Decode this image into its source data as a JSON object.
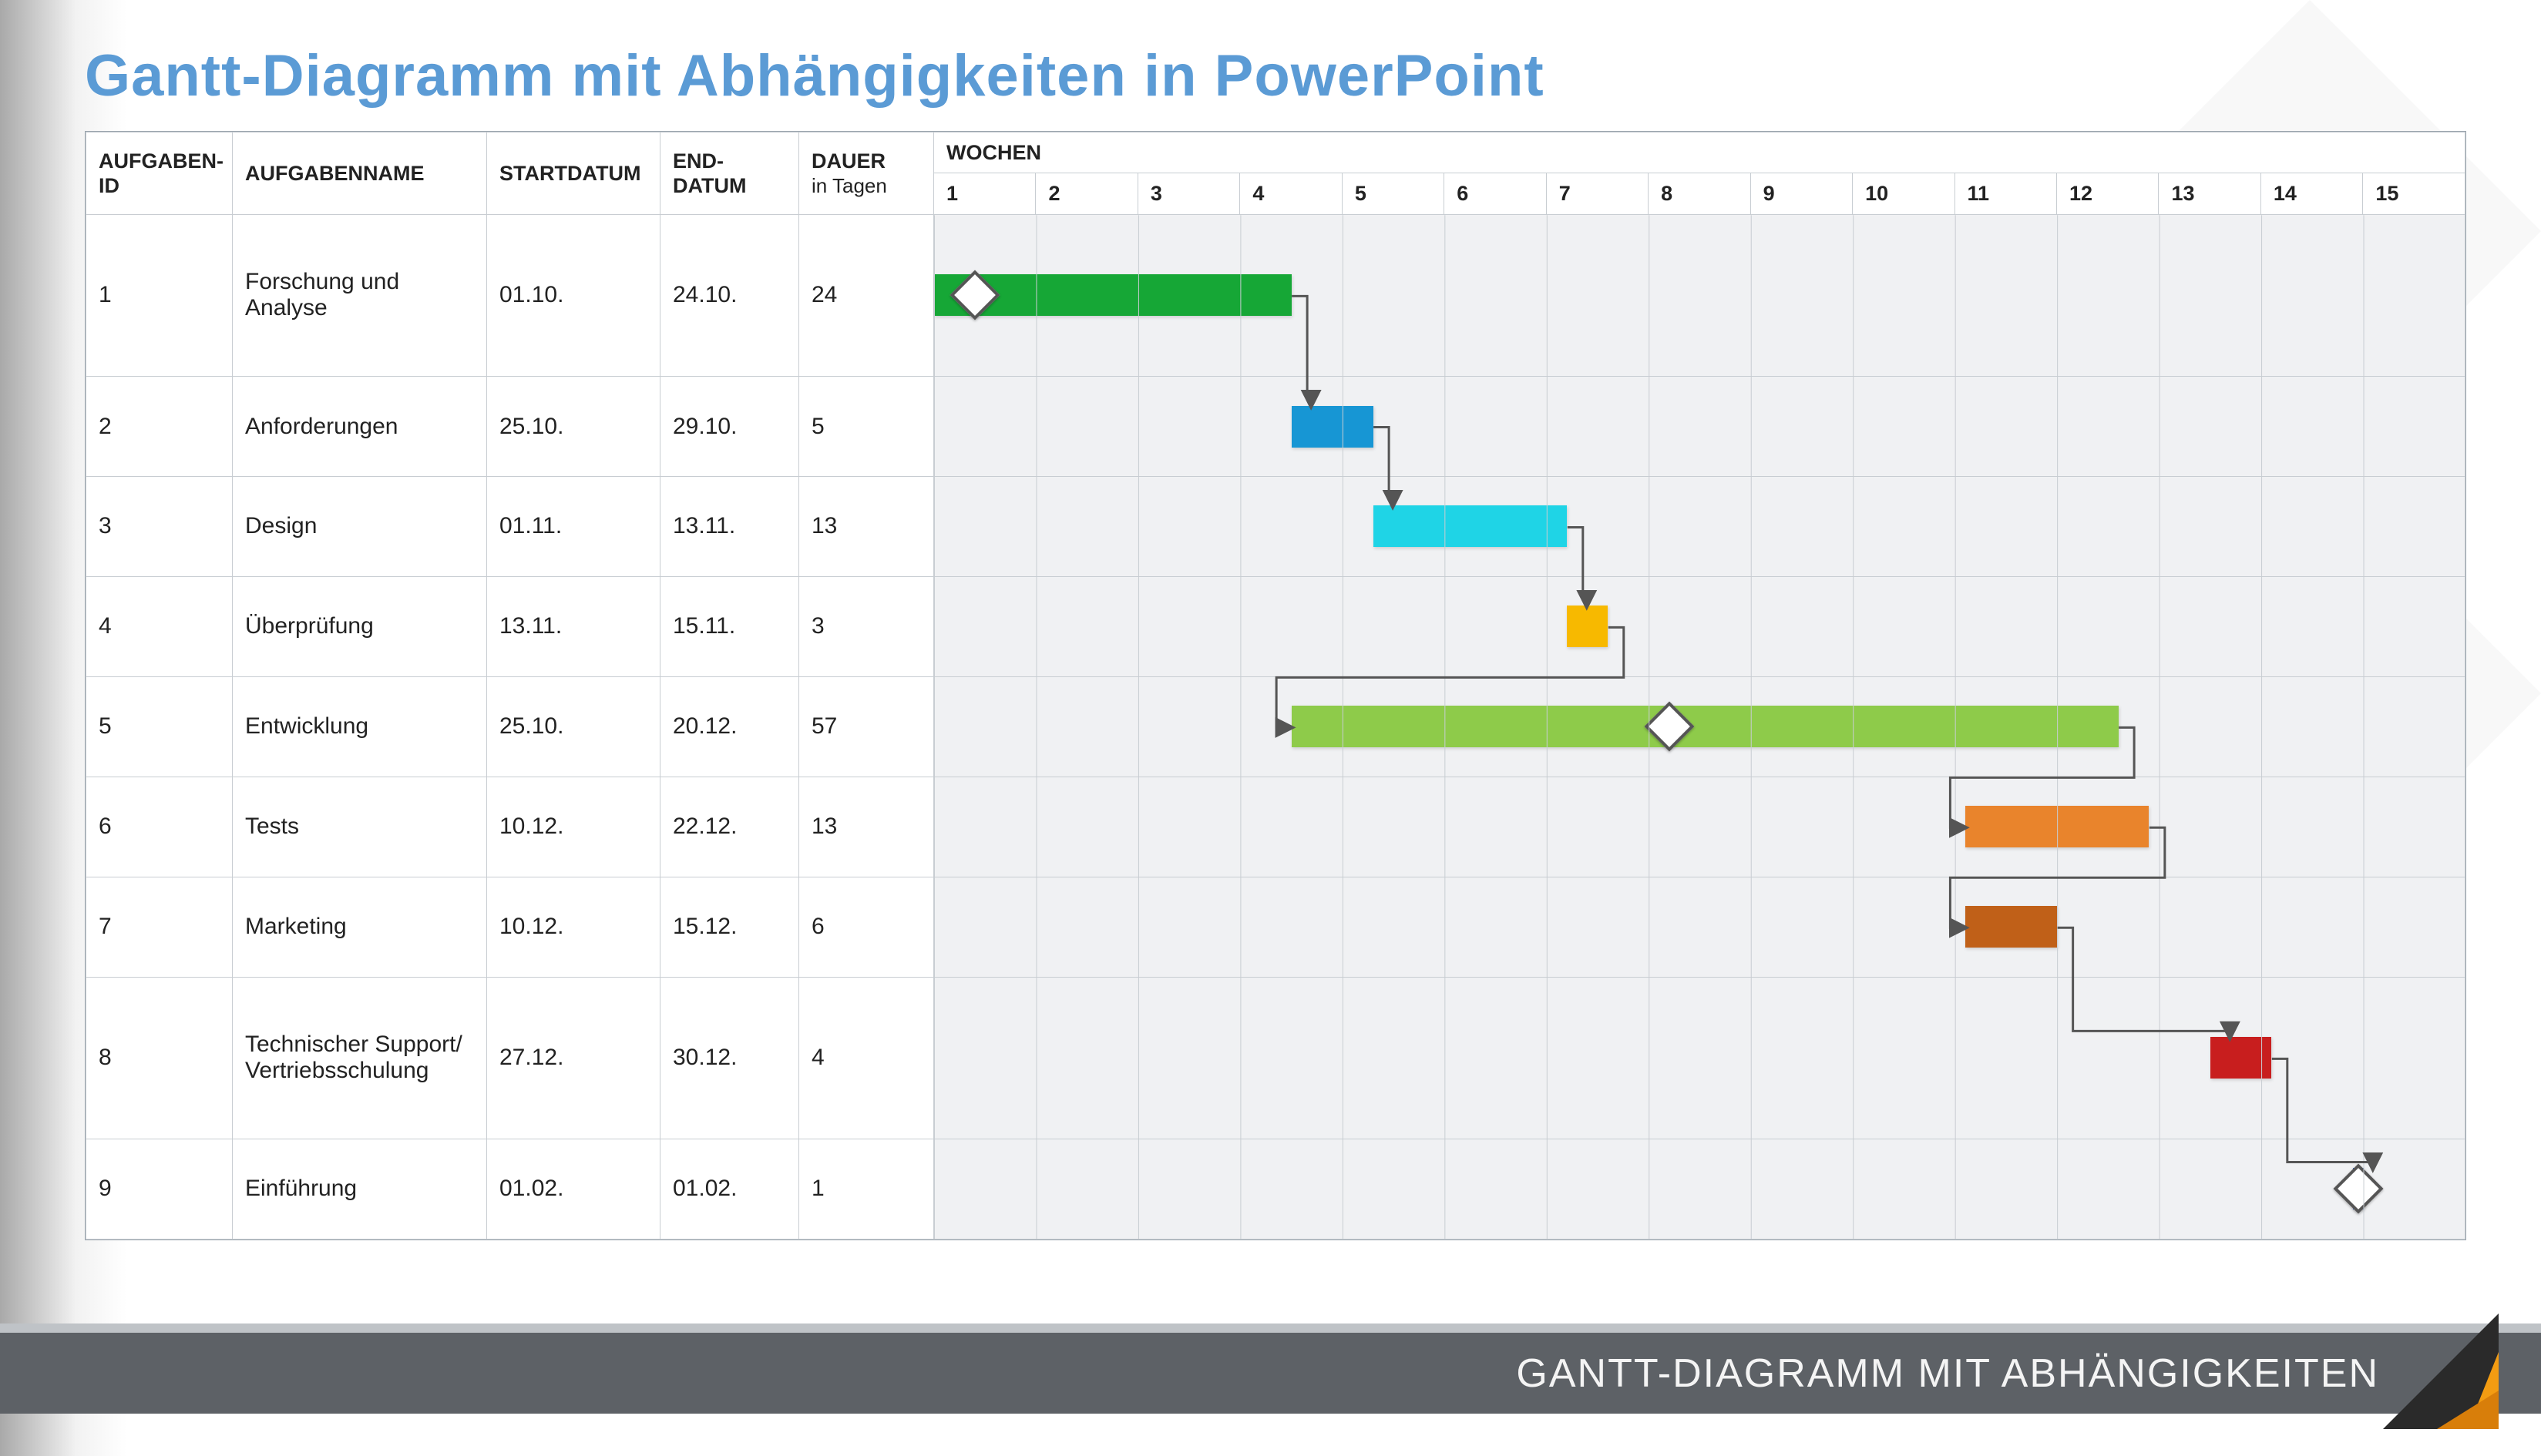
{
  "title": "Gantt-Diagramm mit Abhängigkeiten in PowerPoint",
  "footer": "GANTT-DIAGRAMM MIT ABHÄNGIGKEITEN",
  "columns": {
    "id": "AUFGABEN-ID",
    "name": "AUFGABENNAME",
    "start": "STARTDATUM",
    "end": "END-DATUM",
    "dur_label": "DAUER",
    "dur_sub": "in Tagen",
    "weeks": "WOCHEN"
  },
  "week_numbers": [
    "1",
    "2",
    "3",
    "4",
    "5",
    "6",
    "7",
    "8",
    "9",
    "10",
    "11",
    "12",
    "13",
    "14",
    "15"
  ],
  "tasks": [
    {
      "id": "1",
      "name": "Forschung und Analyse",
      "start": "01.10.",
      "end": "24.10.",
      "dur": "24"
    },
    {
      "id": "2",
      "name": "Anforderungen",
      "start": "25.10.",
      "end": "29.10.",
      "dur": "5"
    },
    {
      "id": "3",
      "name": "Design",
      "start": "01.11.",
      "end": "13.11.",
      "dur": "13"
    },
    {
      "id": "4",
      "name": "Überprüfung",
      "start": "13.11.",
      "end": "15.11.",
      "dur": "3"
    },
    {
      "id": "5",
      "name": "Entwicklung",
      "start": "25.10.",
      "end": "20.12.",
      "dur": "57"
    },
    {
      "id": "6",
      "name": "Tests",
      "start": "10.12.",
      "end": "22.12.",
      "dur": "13"
    },
    {
      "id": "7",
      "name": "Marketing",
      "start": "10.12.",
      "end": "15.12.",
      "dur": "6"
    },
    {
      "id": "8",
      "name": "Technischer Support/ Vertriebsschulung",
      "start": "27.12.",
      "end": "30.12.",
      "dur": "4"
    },
    {
      "id": "9",
      "name": "Einführung",
      "start": "01.02.",
      "end": "01.02.",
      "dur": "1"
    }
  ],
  "chart_data": {
    "type": "gantt",
    "title": "Gantt-Diagramm mit Abhängigkeiten in PowerPoint",
    "xlabel": "WOCHEN",
    "x_categories": [
      1,
      2,
      3,
      4,
      5,
      6,
      7,
      8,
      9,
      10,
      11,
      12,
      13,
      14,
      15
    ],
    "xlim": [
      1,
      15
    ],
    "bars": [
      {
        "task": "Forschung und Analyse",
        "row": 1,
        "start_week": 1.0,
        "end_week": 4.5,
        "color": "#16a736",
        "milestone_at": 1.4
      },
      {
        "task": "Anforderungen",
        "row": 2,
        "start_week": 4.5,
        "end_week": 5.3,
        "color": "#1796d4"
      },
      {
        "task": "Design",
        "row": 3,
        "start_week": 5.3,
        "end_week": 7.2,
        "color": "#1fd4e6"
      },
      {
        "task": "Überprüfung",
        "row": 4,
        "start_week": 7.2,
        "end_week": 7.6,
        "color": "#f7b900"
      },
      {
        "task": "Entwicklung",
        "row": 5,
        "start_week": 4.5,
        "end_week": 12.6,
        "color": "#8ecb4a",
        "milestone_at": 8.2
      },
      {
        "task": "Tests",
        "row": 6,
        "start_week": 11.1,
        "end_week": 12.9,
        "color": "#e9842c"
      },
      {
        "task": "Marketing",
        "row": 7,
        "start_week": 11.1,
        "end_week": 12.0,
        "color": "#c06018"
      },
      {
        "task": "Technischer Support/ Vertriebsschulung",
        "row": 8,
        "start_week": 13.5,
        "end_week": 14.1,
        "color": "#c81e1e"
      },
      {
        "task": "Einführung",
        "row": 9,
        "start_week": 14.9,
        "end_week": 15.0,
        "color": "#1e55c8",
        "milestone_at": 14.95
      }
    ],
    "dependencies": [
      {
        "from": 1,
        "to": 2
      },
      {
        "from": 2,
        "to": 3
      },
      {
        "from": 3,
        "to": 4
      },
      {
        "from": 4,
        "to": 5
      },
      {
        "from": 5,
        "to": 6
      },
      {
        "from": 6,
        "to": 7
      },
      {
        "from": 7,
        "to": 8
      },
      {
        "from": 8,
        "to": 9
      }
    ]
  },
  "colors": {
    "title": "#5b9bd5",
    "footer_bg": "#5d6166",
    "accent_orange": "#f39c12",
    "grid": "#c8cdd2"
  }
}
